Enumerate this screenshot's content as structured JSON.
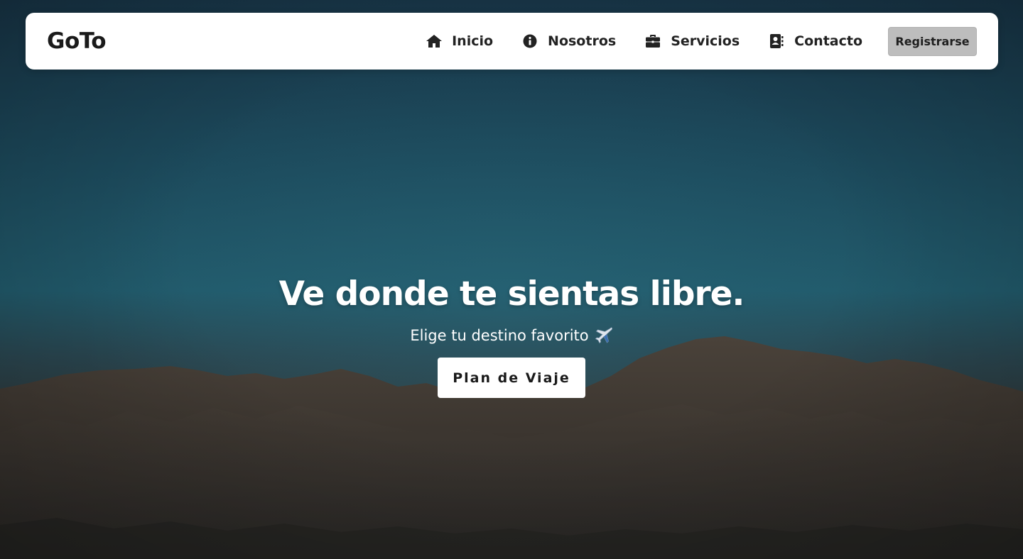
{
  "brand": {
    "name": "GoTo"
  },
  "nav": {
    "items": [
      {
        "label": "Inicio",
        "icon": "home-icon"
      },
      {
        "label": "Nosotros",
        "icon": "info-circle-icon"
      },
      {
        "label": "Servicios",
        "icon": "briefcase-icon"
      },
      {
        "label": "Contacto",
        "icon": "address-book-icon"
      }
    ],
    "register_label": "Registrarse"
  },
  "hero": {
    "title": "Ve donde te sientas libre.",
    "subtitle": "Elige tu destino favorito",
    "subtitle_icon": "airplane-icon",
    "cta_label": "Plan de Viaje"
  },
  "colors": {
    "navbar_bg": "#ffffff",
    "register_bg": "#bdbdbd",
    "sky_top": "#183547",
    "sky_mid": "#215a6b",
    "mountains": "#3a3530",
    "cta_bg": "#ffffff"
  }
}
